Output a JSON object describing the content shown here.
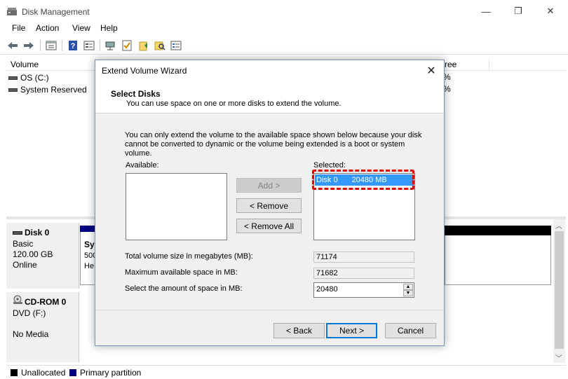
{
  "window": {
    "title": "Disk Management",
    "controls": {
      "minimize": "—",
      "maximize": "❐",
      "close": "✕"
    }
  },
  "menu": [
    "File",
    "Action",
    "View",
    "Help"
  ],
  "toolbar": {
    "buttons": [
      "back-icon",
      "forward-icon",
      "properties-icon",
      "help-icon",
      "disk-list-icon",
      "connect-icon",
      "check-icon",
      "folder-icon",
      "search-folder-icon",
      "view-icon"
    ]
  },
  "volume_list": {
    "columns": [
      "Volume",
      "ree"
    ],
    "rows": [
      {
        "name": "OS (C:)",
        "tail": "%"
      },
      {
        "name": "System Reserved",
        "tail": "%"
      }
    ]
  },
  "disks": [
    {
      "name": "Disk 0",
      "type": "Basic",
      "size": "120.00 GB",
      "status": "Online",
      "partition_title": "Sys",
      "partition_line2": "500",
      "partition_line3": "He"
    },
    {
      "name": "CD-ROM 0",
      "type": "DVD (F:)",
      "status": "No Media"
    }
  ],
  "legend": [
    {
      "label": "Unallocated",
      "color": "#000000"
    },
    {
      "label": "Primary partition",
      "color": "#000080"
    }
  ],
  "dialog": {
    "title": "Extend Volume Wizard",
    "close": "✕",
    "heading": "Select Disks",
    "subheading": "You can use space on one or more disks to extend the volume.",
    "info": "You can only extend the volume to the available space shown below because your disk cannot be converted to dynamic or the volume being extended is a boot or system volume.",
    "available_label": "Available:",
    "selected_label": "Selected:",
    "selected_items": [
      {
        "disk": "Disk 0",
        "size": "20480 MB"
      }
    ],
    "add_button": "Add >",
    "remove_button": "< Remove",
    "remove_all_button": "< Remove All",
    "total_label": "Total volume size in megabytes (MB):",
    "total_value": "71174",
    "max_label": "Maximum available space in MB:",
    "max_value": "71682",
    "amount_label": "Select the amount of space in MB:",
    "amount_value": "20480",
    "back_button": "< Back",
    "next_button": "Next >",
    "cancel_button": "Cancel"
  },
  "colors": {
    "highlight": "#e00000",
    "selection": "#3399ff",
    "primary_partition": "#000080"
  }
}
